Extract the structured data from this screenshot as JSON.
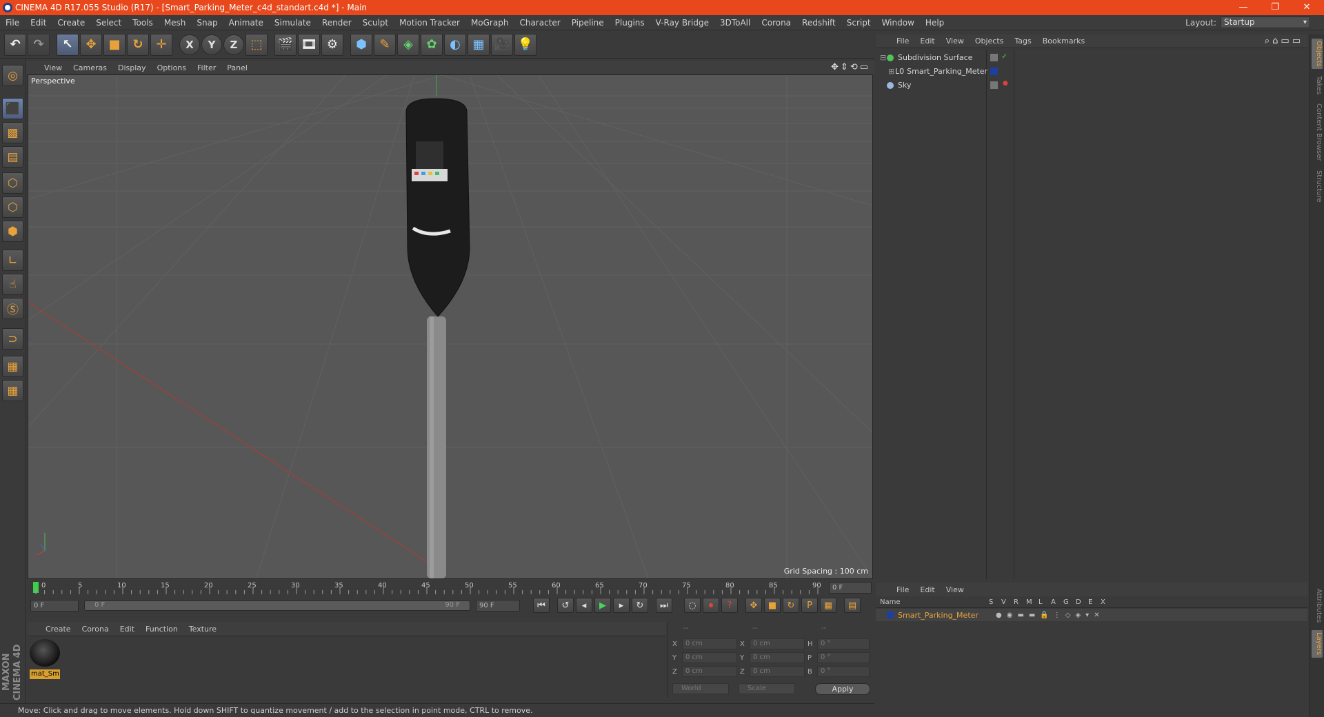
{
  "window": {
    "title": "CINEMA 4D R17.055 Studio (R17) - [Smart_Parking_Meter_c4d_standart.c4d *] - Main",
    "minimize": "—",
    "restore": "❐",
    "close": "✕"
  },
  "menubar": {
    "items": [
      "File",
      "Edit",
      "Create",
      "Select",
      "Tools",
      "Mesh",
      "Snap",
      "Animate",
      "Simulate",
      "Render",
      "Sculpt",
      "Motion Tracker",
      "MoGraph",
      "Character",
      "Pipeline",
      "Plugins",
      "V-Ray Bridge",
      "3DToAll",
      "Corona",
      "Redshift",
      "Script",
      "Window",
      "Help"
    ],
    "layout_label": "Layout:",
    "layout_value": "Startup"
  },
  "viewport": {
    "menu": [
      "View",
      "Cameras",
      "Display",
      "Options",
      "Filter",
      "Panel"
    ],
    "camera": "Perspective",
    "grid_spacing": "Grid Spacing : 100 cm"
  },
  "timeline": {
    "ticks": [
      "0",
      "5",
      "10",
      "15",
      "20",
      "25",
      "30",
      "35",
      "40",
      "45",
      "50",
      "55",
      "60",
      "65",
      "70",
      "75",
      "80",
      "85",
      "90"
    ],
    "current_frame": "0 F",
    "start_frame": "0 F",
    "range_start": "0 F",
    "range_end": "90 F",
    "end_frame": "90 F"
  },
  "materials": {
    "menu": [
      "Create",
      "Corona",
      "Edit",
      "Function",
      "Texture"
    ],
    "items": [
      {
        "name": "mat_Sm"
      }
    ]
  },
  "coordinates": {
    "headers": [
      "--",
      "--",
      "--"
    ],
    "rows": [
      {
        "l1": "X",
        "v1": "0 cm",
        "l2": "X",
        "v2": "0 cm",
        "l3": "H",
        "v3": "0 °"
      },
      {
        "l1": "Y",
        "v1": "0 cm",
        "l2": "Y",
        "v2": "0 cm",
        "l3": "P",
        "v3": "0 °"
      },
      {
        "l1": "Z",
        "v1": "0 cm",
        "l2": "Z",
        "v2": "0 cm",
        "l3": "B",
        "v3": "0 °"
      }
    ],
    "space": "World",
    "mode": "Scale",
    "apply": "Apply"
  },
  "status": "Move: Click and drag to move elements. Hold down SHIFT to quantize movement / add to the selection in point mode, CTRL to remove.",
  "brand": "MAXON CINEMA 4D",
  "objects": {
    "menu": [
      "File",
      "Edit",
      "View",
      "Objects",
      "Tags",
      "Bookmarks"
    ],
    "items": [
      {
        "name": "Subdivision Surface",
        "color": "#52c25a"
      },
      {
        "name": "Smart_Parking_Meter",
        "color": "#c8c8c8"
      },
      {
        "name": "Sky",
        "color": "#9ab8e0"
      }
    ]
  },
  "layers": {
    "menu": [
      "File",
      "Edit",
      "View"
    ],
    "headers": [
      "Name",
      "S",
      "V",
      "R",
      "M",
      "L",
      "A",
      "G",
      "D",
      "E",
      "X"
    ],
    "row": {
      "name": "Smart_Parking_Meter",
      "color": "#e9a23b"
    }
  },
  "side_tabs": [
    "Objects",
    "Takes",
    "Content Browser",
    "Structure",
    "Attributes",
    "Layers"
  ],
  "colors": {
    "title_bar": "#e8481c",
    "accent": "#e9a23b",
    "selection": "#6f86ad"
  }
}
